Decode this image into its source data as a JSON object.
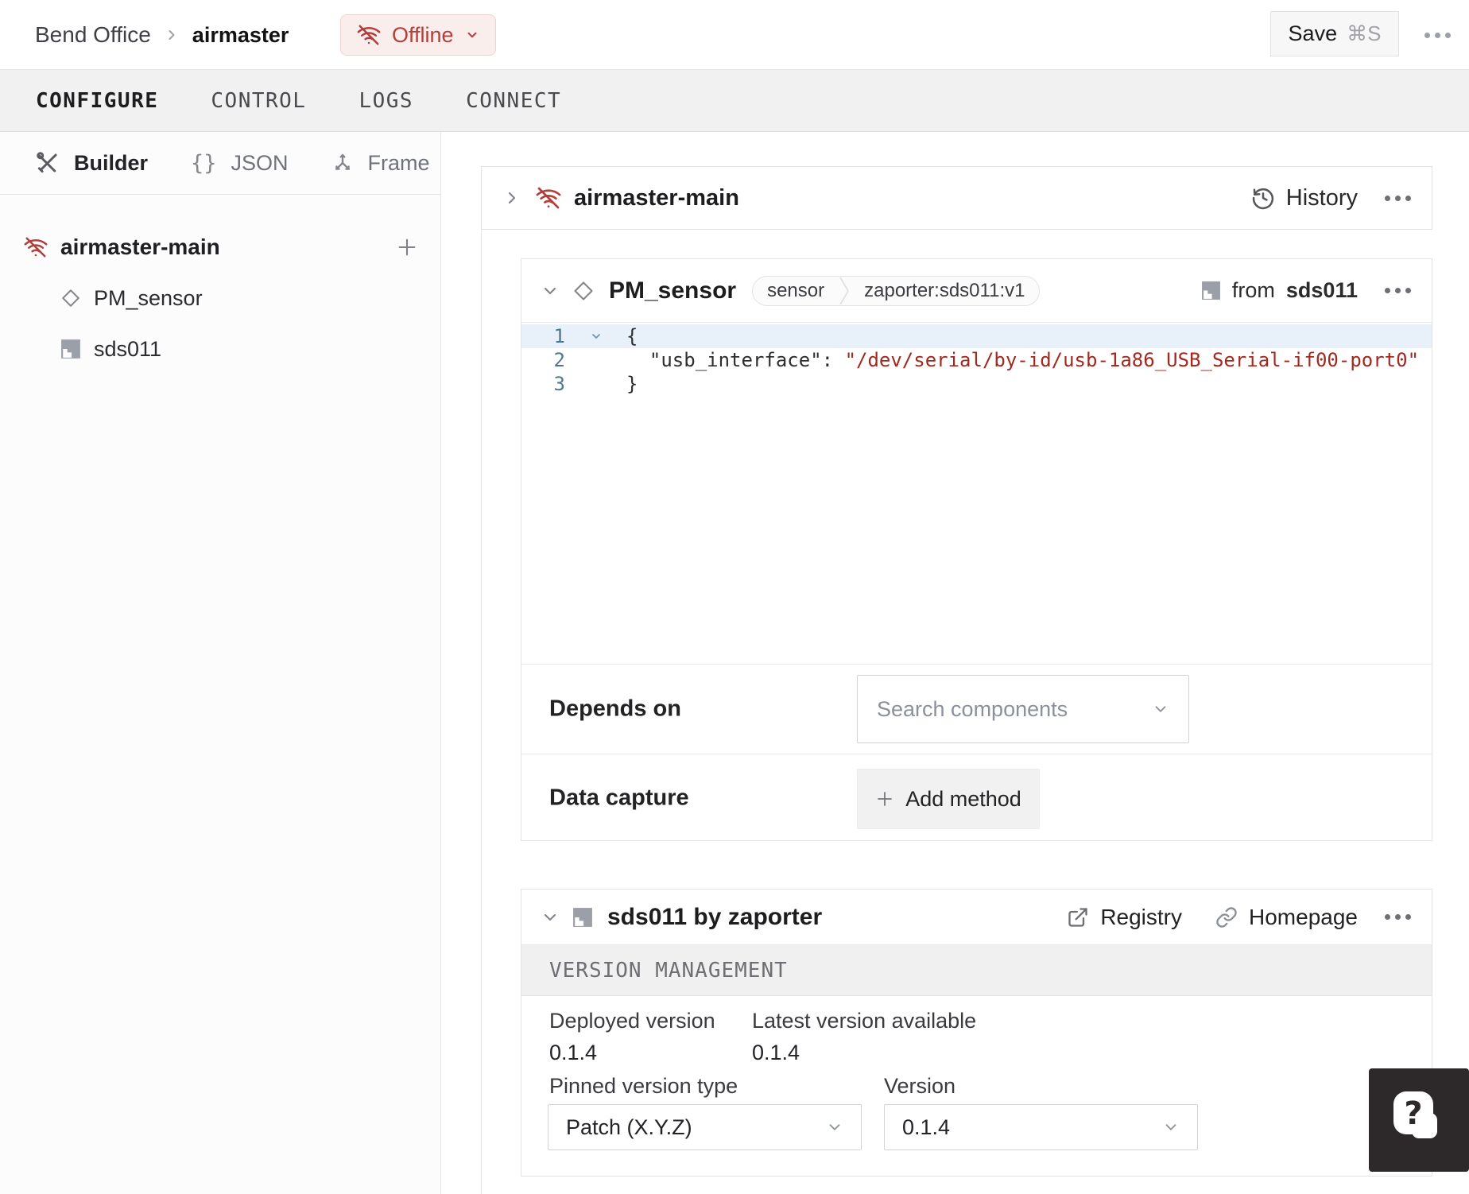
{
  "header": {
    "breadcrumb": {
      "org": "Bend Office",
      "machine": "airmaster"
    },
    "status": {
      "label": "Offline"
    },
    "save": {
      "label": "Save",
      "shortcut": "⌘S"
    }
  },
  "tabs": {
    "active": "CONFIGURE",
    "items": [
      "CONFIGURE",
      "CONTROL",
      "LOGS",
      "CONNECT"
    ]
  },
  "sidebar": {
    "views": {
      "builder": "Builder",
      "json": "JSON",
      "frame": "Frame"
    },
    "tree": {
      "machine": "airmaster-main",
      "component": "PM_sensor",
      "module": "sds011"
    }
  },
  "machine_card": {
    "title": "airmaster-main",
    "history": "History"
  },
  "component_card": {
    "title": "PM_sensor",
    "chip": {
      "type": "sensor",
      "model": "zaporter:sds011:v1"
    },
    "from": {
      "prefix": "from",
      "target": "sds011"
    },
    "code": {
      "n1": "1",
      "n2": "2",
      "n3": "3",
      "l1": "{",
      "l2_indent": "  ",
      "l2_key": "\"usb_interface\"",
      "l2_sep": ": ",
      "l2_value": "\"/dev/serial/by-id/usb-1a86_USB_Serial-if00-port0\"",
      "l3": "}"
    },
    "depends_on": {
      "label": "Depends on",
      "placeholder": "Search components"
    },
    "data_capture": {
      "label": "Data capture",
      "add_button": "Add method"
    }
  },
  "module_card": {
    "title": "sds011 by zaporter",
    "registry": "Registry",
    "homepage": "Homepage",
    "section": "VERSION MANAGEMENT",
    "deployed_label": "Deployed version",
    "deployed_value": "0.1.4",
    "latest_label": "Latest version available",
    "latest_value": "0.1.4",
    "pinned_label": "Pinned version type",
    "pinned_value": "Patch (X.Y.Z)",
    "version_label": "Version",
    "version_value": "0.1.4"
  },
  "colors": {
    "accent_red": "#b23f3c",
    "offline_bg": "#faeeec",
    "offline_border": "#eed3d0",
    "code_string": "#a3281f",
    "line_number": "#4d7791",
    "active_line_bg": "#e8f1f9"
  }
}
